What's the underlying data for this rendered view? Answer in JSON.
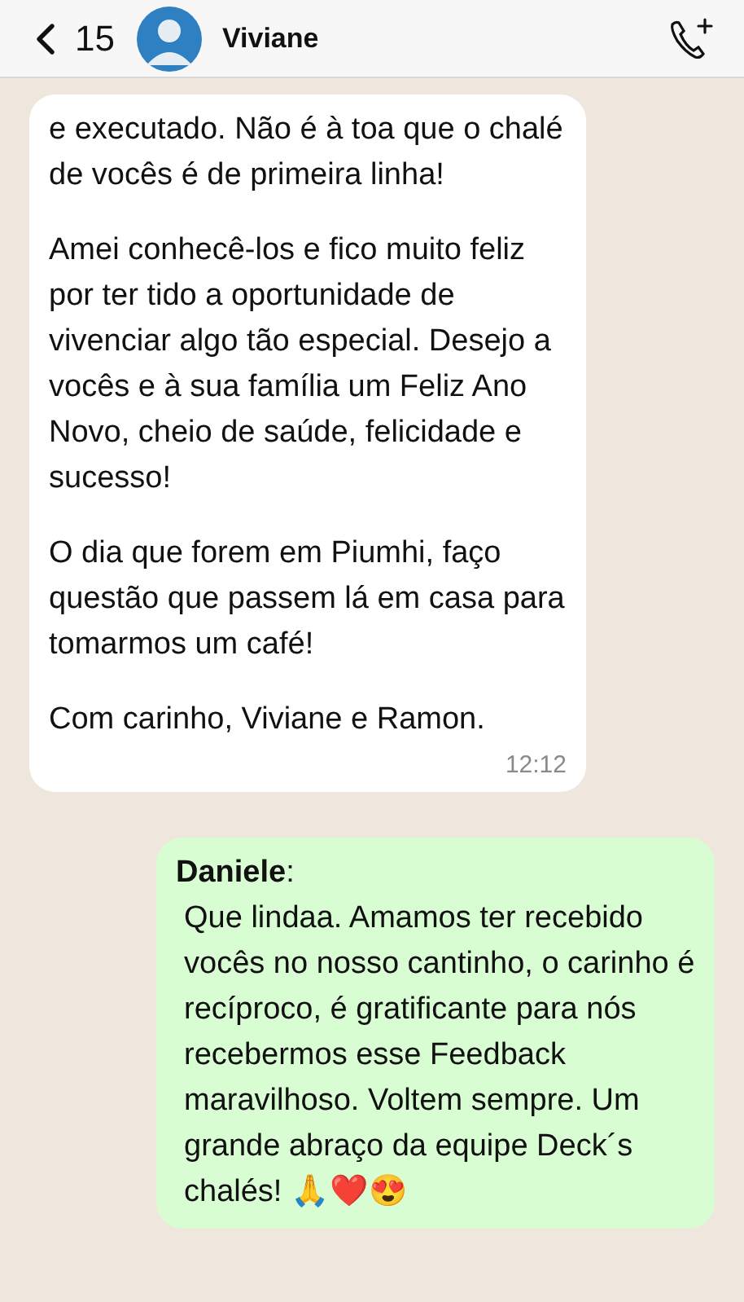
{
  "header": {
    "back_count": "15",
    "contact_name": "Viviane"
  },
  "messages": [
    {
      "kind": "incoming",
      "paragraphs": [
        "e executado. Não é à toa que o chalé de vocês é de primeira linha!",
        "Amei conhecê-los e fico muito feliz por ter tido a oportunidade de vivenciar algo tão especial. Desejo a vocês e à sua família um Feliz Ano Novo, cheio de saúde, felicidade e sucesso!",
        "O dia que forem em Piumhi, faço questão que passem lá em casa para tomarmos um café!",
        "Com carinho, Viviane e Ramon."
      ],
      "time": "12:12"
    },
    {
      "kind": "outgoing",
      "sender": "**Daniele**:",
      "paragraphs": [
        "Que lindaa. Amamos ter recebido vocês no nosso cantinho, o carinho é recíproco, é gratificante para nós recebermos esse Feedback maravilhoso. Voltem sempre. Um grande abraço da equipe Deck´s chalés! 🙏❤️😍"
      ]
    }
  ]
}
